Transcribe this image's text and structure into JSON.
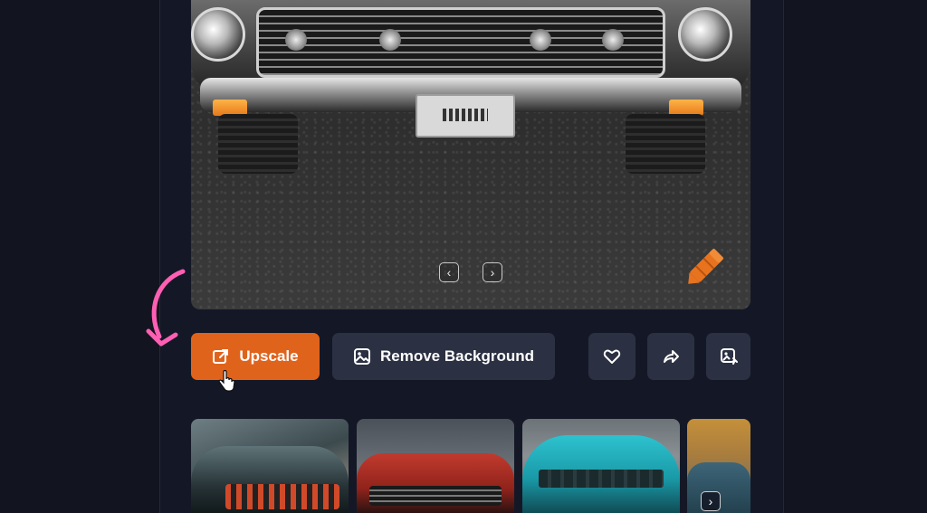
{
  "actions": {
    "upscale_label": "Upscale",
    "remove_background_label": "Remove Background"
  },
  "icons": {
    "prev": "‹",
    "next": "›",
    "like": "heart-icon",
    "share": "share-icon",
    "edit": "image-edit-icon"
  },
  "colors": {
    "accent": "#e0631c",
    "button_dark": "#2b3042",
    "background": "#12151f",
    "annotation_arrow": "#ff5fb3"
  }
}
